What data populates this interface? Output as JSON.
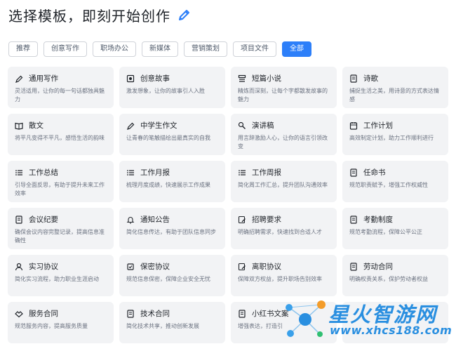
{
  "header": {
    "title": "选择模板，即刻开始创作",
    "icon": "pencil-icon",
    "accent": "#2d7ff9"
  },
  "tabs": [
    {
      "label": "推荐",
      "active": false
    },
    {
      "label": "创意写作",
      "active": false
    },
    {
      "label": "职场办公",
      "active": false
    },
    {
      "label": "新媒体",
      "active": false
    },
    {
      "label": "营销策划",
      "active": false
    },
    {
      "label": "项目文件",
      "active": false
    },
    {
      "label": "全部",
      "active": true
    }
  ],
  "cards": [
    {
      "icon": "pen-icon",
      "title": "通用写作",
      "desc": "灵活适用，让你的每一句话都独具魅力"
    },
    {
      "icon": "book-icon",
      "title": "创意故事",
      "desc": "激发想象，让你的故事引人入胜"
    },
    {
      "icon": "novel-icon",
      "title": "短篇小说",
      "desc": "精炼而深刻，让每个字都散发故事的魅力"
    },
    {
      "icon": "doc-icon",
      "title": "诗歌",
      "desc": "捕捉生活之美，用诗意的方式表达情感"
    },
    {
      "icon": "open-book-icon",
      "title": "散文",
      "desc": "将平凡变得不平凡，感悟生活的韵味"
    },
    {
      "icon": "pen-icon",
      "title": "中学生作文",
      "desc": "让青春的笔触描绘出最真实的自我"
    },
    {
      "icon": "speech-icon",
      "title": "演讲稿",
      "desc": "用言辞激励人心，让你的语言引领改变"
    },
    {
      "icon": "calendar-icon",
      "title": "工作计划",
      "desc": "高效制定计划，助力工作顺利进行"
    },
    {
      "icon": "list-icon",
      "title": "工作总结",
      "desc": "引导全面反思，有助于提升未来工作效率"
    },
    {
      "icon": "list-icon",
      "title": "工作月报",
      "desc": "梳理月度成绩，快速展示工作成果"
    },
    {
      "icon": "list-icon",
      "title": "工作周报",
      "desc": "简化周工作汇总，提升团队沟通效率"
    },
    {
      "icon": "doc-icon",
      "title": "任命书",
      "desc": "规范职责赋予，增强工作权威性"
    },
    {
      "icon": "doc-icon",
      "title": "会议纪要",
      "desc": "确保会议内容完整记录，提高信息准确性"
    },
    {
      "icon": "bell-icon",
      "title": "通知公告",
      "desc": "简化信息传达，有助于团队信息同步"
    },
    {
      "icon": "edit-icon",
      "title": "招聘要求",
      "desc": "明确招聘需求，快速找到合适人才"
    },
    {
      "icon": "doc-icon",
      "title": "考勤制度",
      "desc": "规范考勤流程，保障公平公正"
    },
    {
      "icon": "user-icon",
      "title": "实习协议",
      "desc": "简化实习流程，助力职业生涯启动"
    },
    {
      "icon": "shield-icon",
      "title": "保密协议",
      "desc": "规范信息保密，保障企业安全无忧"
    },
    {
      "icon": "edit-icon",
      "title": "离职协议",
      "desc": "保障双方权益，提升职场告别效率"
    },
    {
      "icon": "doc-icon",
      "title": "劳动合同",
      "desc": "明确权责关系，保护劳动者权益"
    },
    {
      "icon": "handshake-icon",
      "title": "服务合同",
      "desc": "规范服务内容，提高服务质量"
    },
    {
      "icon": "doc-icon",
      "title": "技术合同",
      "desc": "简化技术共享，推动创新发展"
    },
    {
      "icon": "doc-icon",
      "title": "小红书文案",
      "desc": "增强表达，打造引"
    },
    {
      "icon": "doc-icon",
      "title": "",
      "desc": ""
    }
  ],
  "watermark": {
    "text": "星火智游网",
    "sub": "www.xhcs188.com",
    "color": "#2a8fe0"
  }
}
